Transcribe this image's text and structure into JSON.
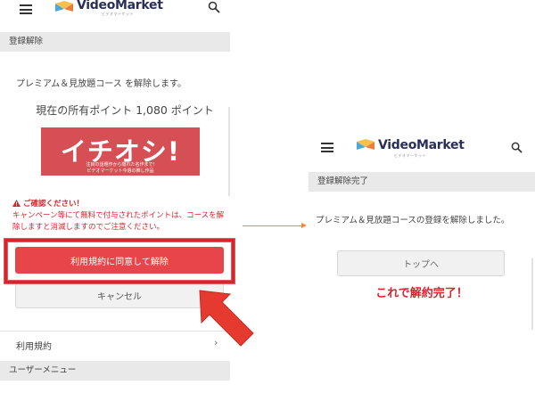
{
  "left": {
    "logo": {
      "name": "VideoMarket",
      "sub": "ビデオマーケット"
    },
    "section_title": "登録解除",
    "description": "プレミアム＆見放題コース を解除します。",
    "points_prefix": "現在の所有ポイント",
    "points_value": "1,080",
    "points_suffix": "ポイント",
    "banner": {
      "headline": "イチオシ!",
      "sub1": "注目の話題作から隠れた名作まで!",
      "sub2": "ビデオマーケット今週の推し作品"
    },
    "warning_title": "ご確認ください！",
    "warning_text": "キャンペーン等にて無料で付与されたポイントは、コースを解除しますと消滅しますのでご注意ください。",
    "agree_button": "利用規約に同意して解除",
    "cancel_button": "キャンセル",
    "terms_link": "利用規約",
    "terms_chevron": "›",
    "user_menu_title": "ユーザーメニュー"
  },
  "right": {
    "logo": {
      "name": "VideoMarket",
      "sub": "ビデオマーケット"
    },
    "section_title": "登録解除完了",
    "description": "プレミアム＆見放題コースの登録を解除しました。",
    "top_button": "トップへ",
    "complete_note": "これで解約完了！"
  },
  "colors": {
    "accent_red": "#d7252c",
    "button_red": "#e8454a",
    "banner_red": "#d64f54",
    "arrow_orange": "#ee8a3a",
    "section_gray": "#e9e9e9"
  },
  "icons": [
    "hamburger-icon",
    "videomarket-logo-icon",
    "search-icon",
    "warning-icon",
    "chevron-right-icon",
    "big-red-arrow-icon"
  ]
}
